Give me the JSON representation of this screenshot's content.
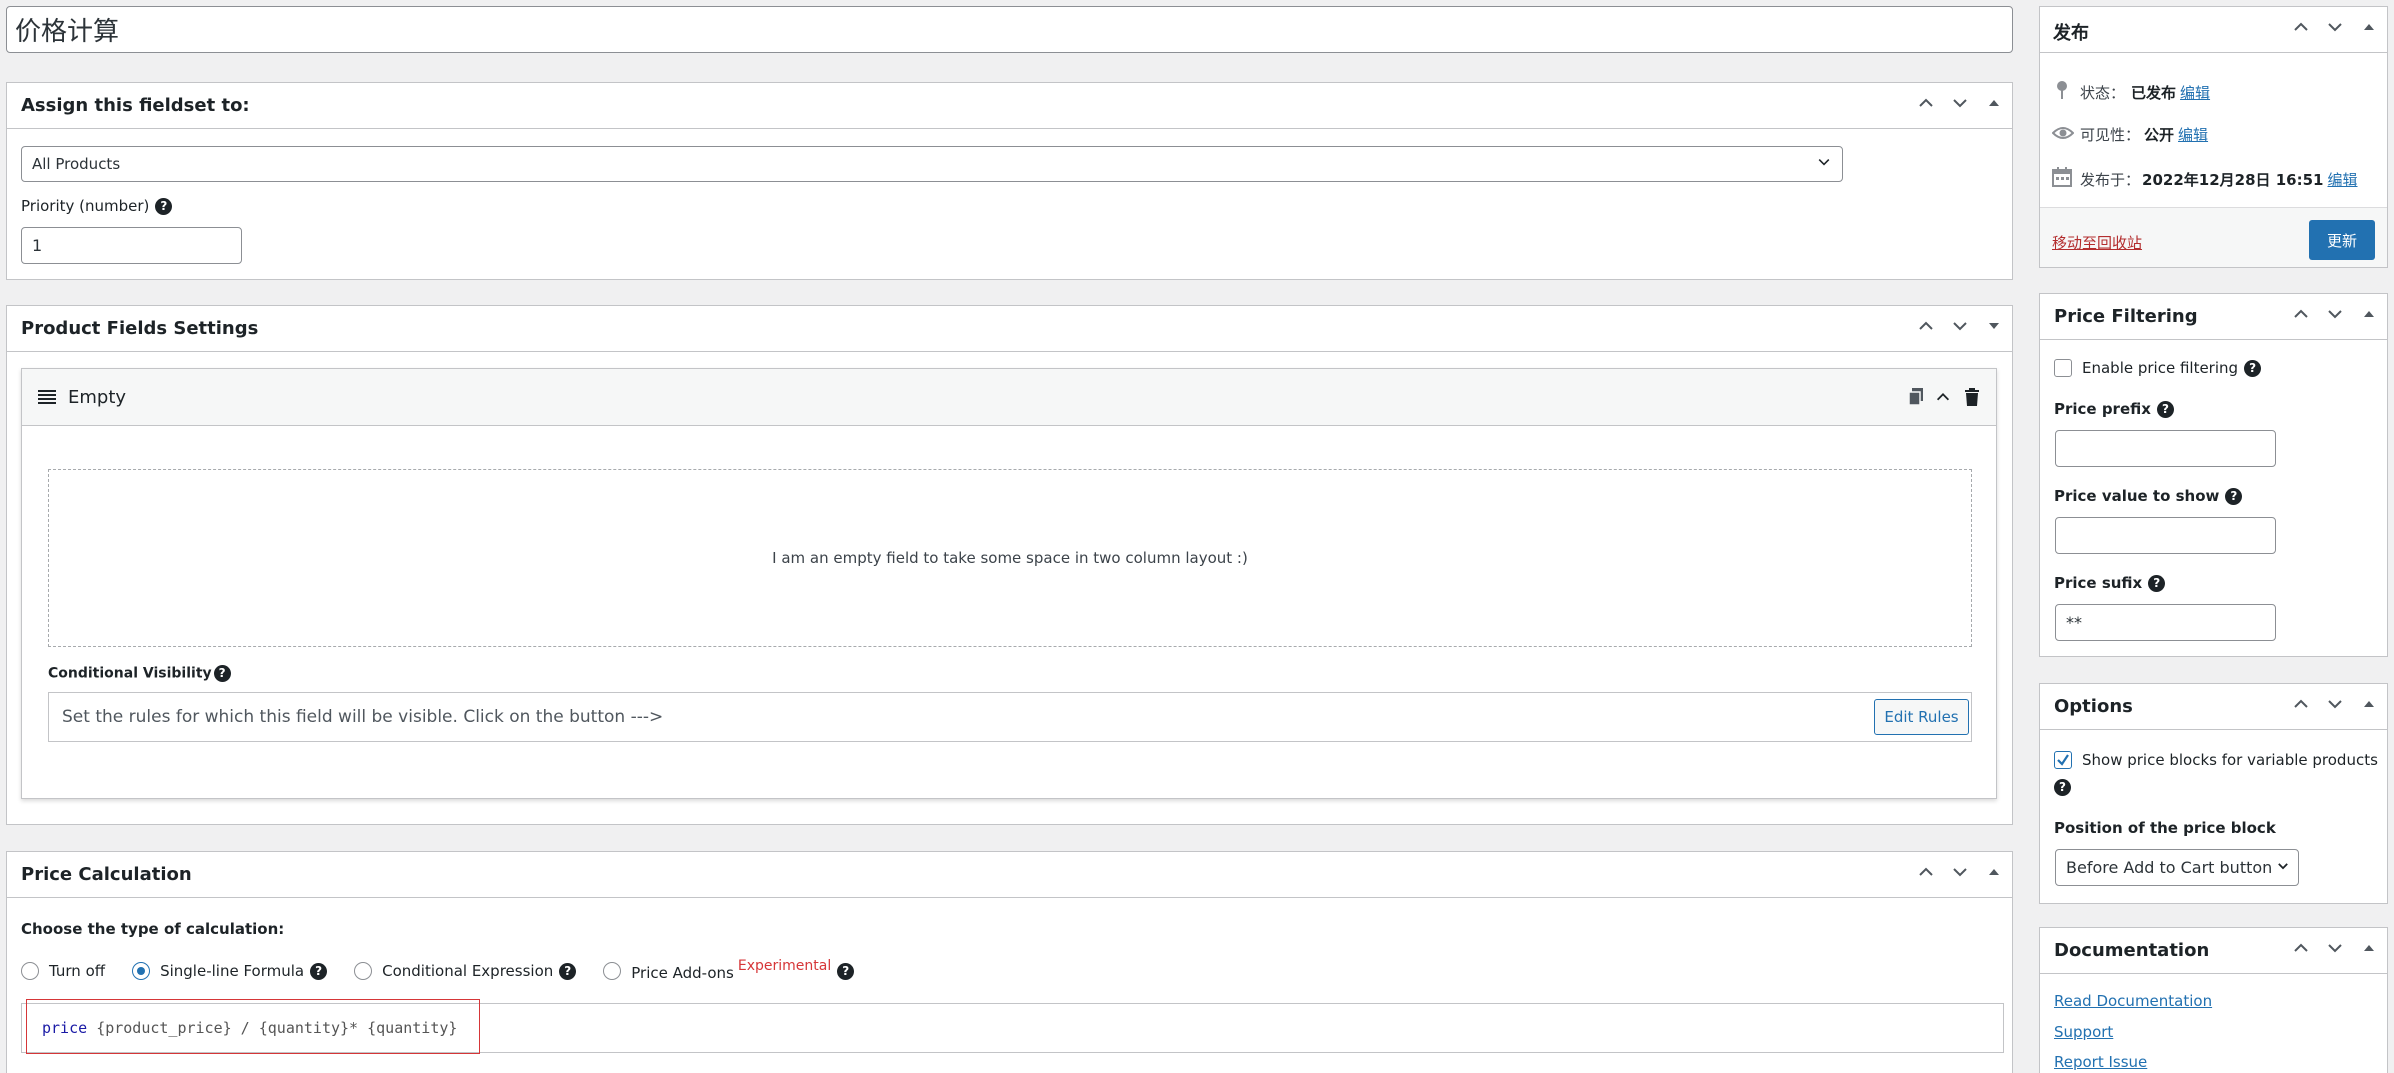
{
  "post_title": "价格计算",
  "fieldset_box": {
    "title": "Assign this fieldset to:",
    "assign_value": "All Products",
    "priority_label": "Priority (number)",
    "priority_value": "1"
  },
  "product_fields_box": {
    "title": "Product Fields Settings",
    "field_name": "Empty",
    "empty_text": "I am an empty field to take some space in two column layout :)",
    "cond_vis_label": "Conditional Visibility",
    "cond_vis_placeholder": "Set the rules for which this field will be visible. Click on the button --->",
    "edit_rules_label": "Edit Rules"
  },
  "price_calc_box": {
    "title": "Price Calculation",
    "choose_label": "Choose the type of calculation:",
    "options": [
      "Turn off",
      "Single-line Formula",
      "Conditional Expression",
      "Price Add-ons"
    ],
    "selected": "Single-line Formula",
    "experimental_badge": "Experimental",
    "formula_keyword": "price",
    "formula_rest": "{product_price} / {quantity}* {quantity}"
  },
  "publish_box": {
    "title": "发布",
    "status_label": "状态：",
    "status_value": "已发布",
    "visibility_label": "可见性：",
    "visibility_value": "公开",
    "published_label": "发布于：",
    "published_value": "2022年12月28日 16:51",
    "edit_link": "编辑",
    "trash_link": "移动至回收站",
    "update_button": "更新"
  },
  "price_filtering_box": {
    "title": "Price Filtering",
    "enable_label": "Enable price filtering",
    "enable_checked": false,
    "prefix_label": "Price prefix",
    "prefix_value": "",
    "value_label": "Price value to show",
    "value_value": "",
    "suffix_label": "Price sufix",
    "suffix_value": "**"
  },
  "options_box": {
    "title": "Options",
    "show_blocks_label": "Show price blocks for variable products",
    "show_blocks_checked": true,
    "position_label": "Position of the price block",
    "position_value": "Before Add to Cart button"
  },
  "documentation_box": {
    "title": "Documentation",
    "links": [
      "Read Documentation",
      "Support",
      "Report Issue"
    ]
  },
  "colors": {
    "accent": "#2271b1",
    "danger": "#b32d2e",
    "experimental": "#d63638"
  }
}
